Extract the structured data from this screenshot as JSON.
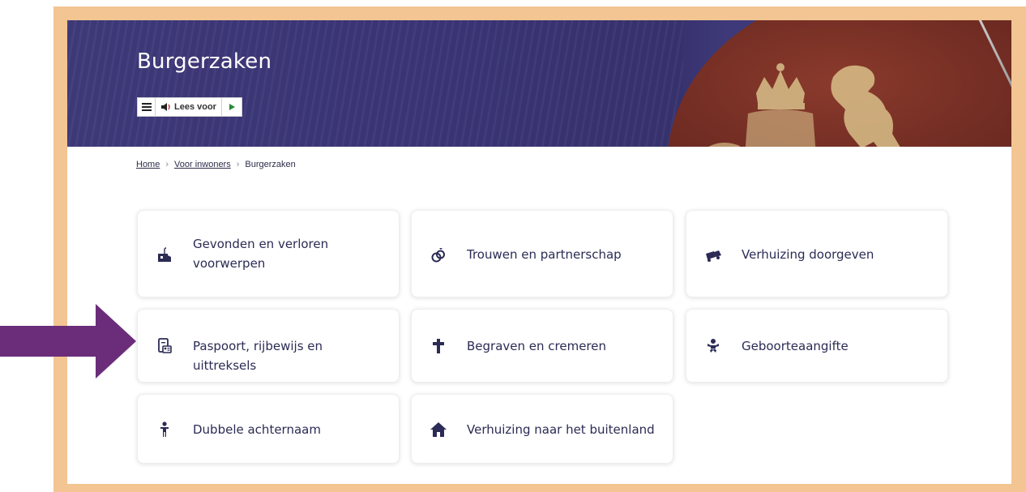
{
  "header": {
    "title": "Burgerzaken",
    "readspeaker": {
      "menu_icon": "hamburger-icon",
      "speaker_icon": "speaker-icon",
      "label": "Lees voor",
      "play_icon": "play-icon"
    }
  },
  "breadcrumb": {
    "items": [
      "Home",
      "Voor inwoners",
      "Burgerzaken"
    ]
  },
  "tiles": [
    {
      "label": "Gevonden en verloren voorwerpen",
      "icon": "lost-found-icon"
    },
    {
      "label": "Trouwen en partnerschap",
      "icon": "rings-icon"
    },
    {
      "label": "Verhuizing doorgeven",
      "icon": "moving-truck-icon"
    },
    {
      "label": "Paspoort, rijbewijs en uittreksels",
      "icon": "passport-icon"
    },
    {
      "label": "Begraven en cremeren",
      "icon": "cross-icon"
    },
    {
      "label": "Geboorteaangifte",
      "icon": "baby-icon"
    },
    {
      "label": "Dubbele achternaam",
      "icon": "person-icon"
    },
    {
      "label": "Verhuizing naar het buitenland",
      "icon": "home-icon"
    }
  ],
  "colors": {
    "frame": "#f2c592",
    "hero": "#3b3577",
    "accent_arrow": "#6b2d7a",
    "text": "#2b2b55"
  }
}
